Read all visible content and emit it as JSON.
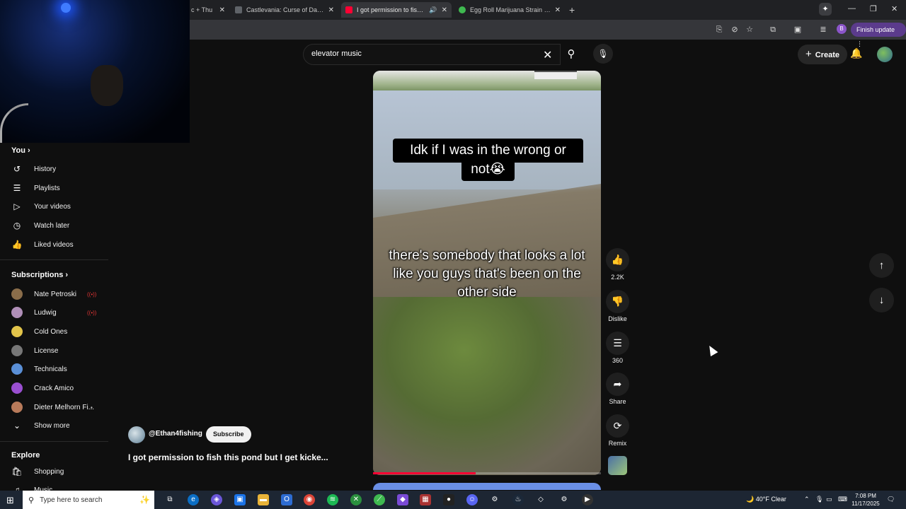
{
  "browser": {
    "tabs": [
      {
        "title": "c + Thu",
        "color": "#4a4a4a"
      },
      {
        "title": "Castlevania: Curse of Darkness",
        "color": "#5f6368"
      },
      {
        "title": "I got permission to fish this",
        "color": "#ff0033"
      },
      {
        "title": "Egg Roll Marijuana Strain Inform",
        "color": "#3fb950"
      }
    ],
    "new_tab": "+",
    "profile_initial": "B",
    "finish_update": "Finish update"
  },
  "header": {
    "search_query": "elevator music",
    "create_label": "Create"
  },
  "sidebar": {
    "you_label": "You",
    "you_items": [
      {
        "label": "History",
        "icon": "history-icon",
        "glyph": "↺"
      },
      {
        "label": "Playlists",
        "icon": "playlists-icon",
        "glyph": "☰"
      },
      {
        "label": "Your videos",
        "icon": "your-videos-icon",
        "glyph": "▷"
      },
      {
        "label": "Watch later",
        "icon": "watch-later-icon",
        "glyph": "◷"
      },
      {
        "label": "Liked videos",
        "icon": "liked-videos-icon",
        "glyph": "👍"
      }
    ],
    "subscriptions_label": "Subscriptions",
    "subscriptions": [
      {
        "label": "Nate Petroski",
        "color": "#8a6d4a",
        "live": true
      },
      {
        "label": "Ludwig",
        "color": "#b08fb8",
        "live": true
      },
      {
        "label": "Cold Ones",
        "color": "#e2c44a",
        "live": false
      },
      {
        "label": "License",
        "color": "#777777",
        "live": false
      },
      {
        "label": "Technicals",
        "color": "#5a8fd6",
        "live": false
      },
      {
        "label": "Crack Amico",
        "color": "#9a4fd1",
        "live": false
      },
      {
        "label": "Dieter Melhorn Fi...",
        "color": "#b87a5a",
        "live": false,
        "dot": true
      }
    ],
    "show_more": "Show more",
    "explore_label": "Explore",
    "explore_items": [
      {
        "label": "Shopping",
        "icon": "shopping-icon",
        "glyph": "🛍"
      },
      {
        "label": "Music",
        "icon": "music-icon",
        "glyph": "♫"
      }
    ]
  },
  "video": {
    "caption_top_line1": "Idk if I was in the wrong or",
    "caption_top_line2": "not😭",
    "caption_subtitle": "there's somebody that looks a lot like you guys that's been on the other side",
    "progress": 0.45,
    "channel": "@Ethan4fishing",
    "subscribe_label": "Subscribe",
    "title": "I got permission to fish this pond but I get kicke..."
  },
  "actions": {
    "like_count": "2.2K",
    "dislike_label": "Dislike",
    "comment_count": "360",
    "share_label": "Share",
    "remix_label": "Remix"
  },
  "taskbar": {
    "search_placeholder": "Type here to search",
    "weather": "40°F  Clear",
    "time": "7:08 PM",
    "date": "11/17/2025"
  }
}
